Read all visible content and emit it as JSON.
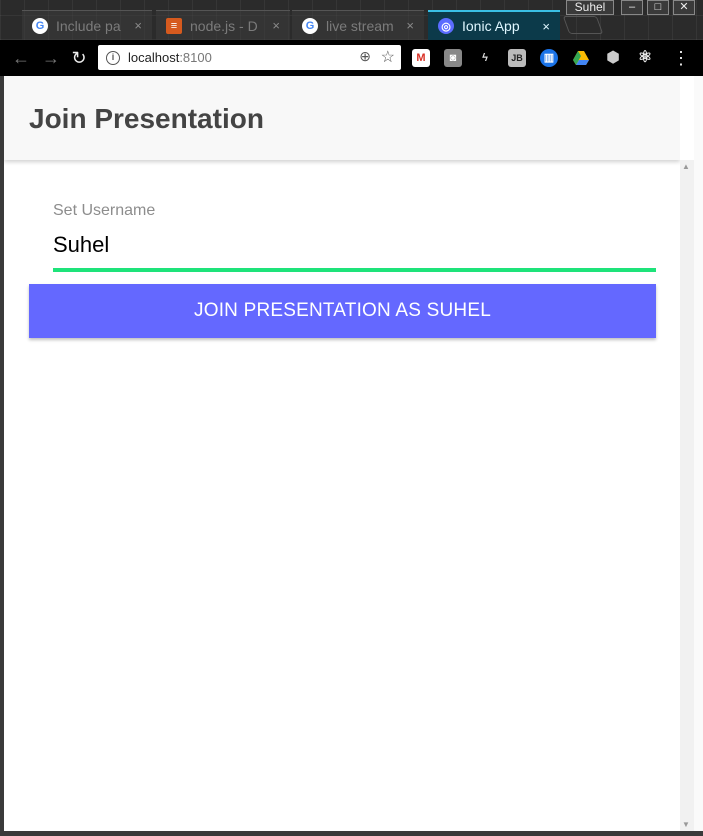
{
  "browser": {
    "tabs": [
      {
        "title": "Include pa",
        "active": false
      },
      {
        "title": "node.js - D",
        "active": false
      },
      {
        "title": "live stream",
        "active": false
      },
      {
        "title": "Ionic App",
        "active": true
      }
    ],
    "close_glyph": "×",
    "profile_name": "Suhel",
    "url_host": "localhost",
    "url_port": ":8100",
    "extension_icons": [
      "gmail-icon",
      "camera-icon",
      "lightning-icon",
      "jb-icon",
      "bank-icon",
      "drive-icon",
      "cube-icon",
      "react-icon"
    ]
  },
  "app": {
    "header_title": "Join Presentation",
    "field_label": "Set Username",
    "field_value": "Suhel",
    "join_button_label": "JOIN PRESENTATION AS SUHEL",
    "colors": {
      "button_bg": "#6468ff",
      "input_underline": "#1ee37a",
      "header_bg": "#f8f8f8"
    }
  }
}
